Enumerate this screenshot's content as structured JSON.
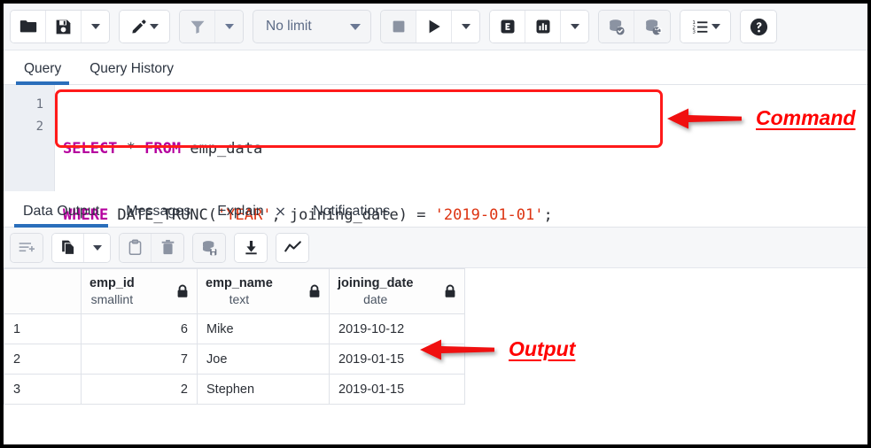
{
  "toolbar": {
    "buttons": [
      {
        "name": "open-file-button",
        "icon": "folder-icon",
        "label": "Open File"
      },
      {
        "name": "save-file-button",
        "icon": "save-icon",
        "label": "Save File"
      },
      {
        "name": "save-file-dropdown",
        "icon": "chevron-down-icon",
        "label": "Save options"
      },
      {
        "name": "edit-button",
        "icon": "pencil-icon",
        "label": "Edit"
      },
      {
        "name": "edit-dropdown",
        "icon": "chevron-down-icon",
        "label": "Edit options"
      },
      {
        "name": "filter-button",
        "icon": "filter-icon",
        "label": "Filter"
      },
      {
        "name": "filter-dropdown",
        "icon": "chevron-down-icon",
        "label": "Filter options"
      },
      {
        "name": "stop-button",
        "icon": "stop-square-icon",
        "label": "Stop"
      },
      {
        "name": "execute-button",
        "icon": "play-icon",
        "label": "Execute"
      },
      {
        "name": "execute-dropdown",
        "icon": "chevron-down-icon",
        "label": "Execute options"
      },
      {
        "name": "explain-button",
        "icon": "explain-e-icon",
        "label": "Explain"
      },
      {
        "name": "explain-analyze-button",
        "icon": "bar-chart-icon",
        "label": "Explain Analyze"
      },
      {
        "name": "explain-dropdown",
        "icon": "chevron-down-icon",
        "label": "Explain options"
      },
      {
        "name": "commit-button",
        "icon": "database-check-icon",
        "label": "Commit"
      },
      {
        "name": "rollback-button",
        "icon": "database-undo-icon",
        "label": "Rollback"
      },
      {
        "name": "macros-button",
        "icon": "numbered-list-icon",
        "label": "Macros"
      },
      {
        "name": "help-button",
        "icon": "question-circle-icon",
        "label": "Help"
      }
    ],
    "row_limit": {
      "value": "No limit",
      "caret": "chevron-down-icon"
    }
  },
  "query_tabs": [
    {
      "label": "Query",
      "active": true
    },
    {
      "label": "Query History",
      "active": false
    }
  ],
  "editor": {
    "line_numbers": [
      "1",
      "2"
    ],
    "lines": [
      {
        "tokens": [
          {
            "t": "SELECT",
            "c": "kw"
          },
          {
            "t": " * ",
            "c": "op"
          },
          {
            "t": "FROM",
            "c": "kw"
          },
          {
            "t": " emp_data",
            "c": "op"
          }
        ]
      },
      {
        "tokens": [
          {
            "t": "WHERE",
            "c": "kw"
          },
          {
            "t": " DATE_TRUNC(",
            "c": "op"
          },
          {
            "t": "'YEAR'",
            "c": "str"
          },
          {
            "t": ", joining_date) = ",
            "c": "op"
          },
          {
            "t": "'2019-01-01'",
            "c": "str"
          },
          {
            "t": ";",
            "c": "op"
          }
        ]
      }
    ],
    "full_text": "SELECT * FROM emp_data\nWHERE DATE_TRUNC('YEAR', joining_date) = '2019-01-01';"
  },
  "annotations": [
    {
      "name": "command-annotation",
      "label": "Command",
      "color": "#ff0000"
    },
    {
      "name": "output-annotation",
      "label": "Output",
      "color": "#ff0000"
    }
  ],
  "output_tabs": [
    {
      "label": "Data Output",
      "active": true,
      "closable": false
    },
    {
      "label": "Messages",
      "active": false,
      "closable": false
    },
    {
      "label": "Explain",
      "active": false,
      "closable": true,
      "close": "×"
    },
    {
      "label": "Notifications",
      "active": false,
      "closable": false
    }
  ],
  "data_toolbar": {
    "buttons": [
      {
        "name": "add-row-button",
        "icon": "add-row-icon",
        "label": "Add row"
      },
      {
        "name": "copy-button",
        "icon": "copy-icon",
        "label": "Copy"
      },
      {
        "name": "copy-dropdown",
        "icon": "chevron-down-icon",
        "label": "Copy options"
      },
      {
        "name": "paste-button",
        "icon": "clipboard-icon",
        "label": "Paste"
      },
      {
        "name": "delete-button",
        "icon": "trash-icon",
        "label": "Delete"
      },
      {
        "name": "save-data-button",
        "icon": "database-save-icon",
        "label": "Save Data Changes"
      },
      {
        "name": "download-button",
        "icon": "download-icon",
        "label": "Download as CSV"
      },
      {
        "name": "graph-button",
        "icon": "line-chart-icon",
        "label": "Graph Visualiser"
      }
    ]
  },
  "grid": {
    "row_number_header": "",
    "columns": [
      {
        "name": "emp_id",
        "type": "smallint",
        "lock": "lock-icon",
        "align": "num"
      },
      {
        "name": "emp_name",
        "type": "text",
        "lock": "lock-icon",
        "align": "txt"
      },
      {
        "name": "joining_date",
        "type": "date",
        "lock": "lock-icon",
        "align": "txt"
      }
    ],
    "rows": [
      {
        "n": "1",
        "cells": [
          "6",
          "Mike",
          "2019-10-12"
        ]
      },
      {
        "n": "2",
        "cells": [
          "7",
          "Joe",
          "2019-01-15"
        ]
      },
      {
        "n": "3",
        "cells": [
          "2",
          "Stephen",
          "2019-01-15"
        ]
      }
    ]
  },
  "colors": {
    "accent_blue": "#2a6ebb",
    "annotation_red": "#ff0000",
    "keyword_magenta": "#b5009e",
    "string_red": "#dd3311",
    "toolbar_bg": "#f6f7f9",
    "gutter_bg": "#eceff4"
  }
}
